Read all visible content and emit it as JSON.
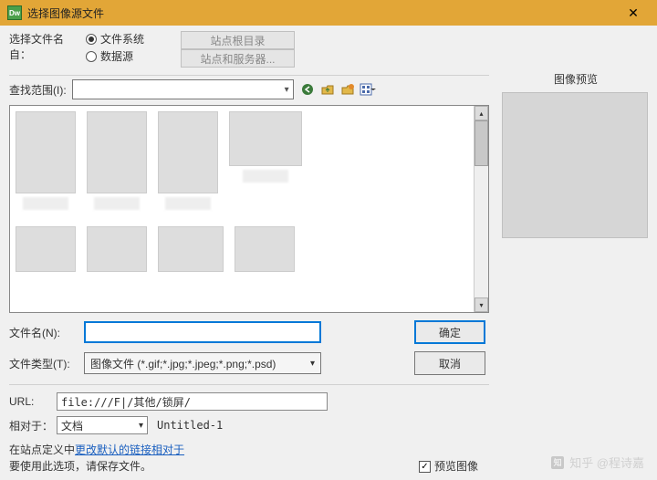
{
  "window": {
    "title": "选择图像源文件",
    "icon_text": "Dw"
  },
  "select_from": {
    "label": "选择文件名自：",
    "options": {
      "filesystem": "文件系统",
      "datasource": "数据源"
    }
  },
  "site_buttons": {
    "root": "站点根目录",
    "server": "站点和服务器..."
  },
  "lookin": {
    "label": "查找范围(I):",
    "value": ""
  },
  "filename": {
    "label": "文件名(N):",
    "value": ""
  },
  "filetype": {
    "label": "文件类型(T):",
    "value": "图像文件 (*.gif;*.jpg;*.jpeg;*.png;*.psd)"
  },
  "buttons": {
    "ok": "确定",
    "cancel": "取消"
  },
  "url": {
    "label": "URL:",
    "value": "file:///F|/其他/锁屏/"
  },
  "relative": {
    "label": "相对于：",
    "value": "文档",
    "untitled": "Untitled-1"
  },
  "info": {
    "prefix": "在站点定义中",
    "link": "更改默认的链接相对于",
    "line2": "要使用此选项，请保存文件。"
  },
  "preview": {
    "checkbox": "预览图像",
    "title": "图像预览"
  },
  "watermark": "知乎 @程诗嘉"
}
